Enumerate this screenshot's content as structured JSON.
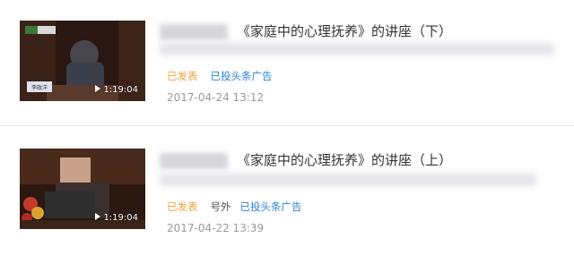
{
  "articles": [
    {
      "title": "《家庭中的心理抚养》的讲座（下）",
      "duration": "1:19:04",
      "status": "已发表",
      "extra": "",
      "channel": "已投头条广告",
      "date": "2017-04-24 13:12",
      "thumb_caption": "李政洋"
    },
    {
      "title": "《家庭中的心理抚养》的讲座（上）",
      "duration": "1:19:04",
      "status": "已发表",
      "extra": "号外",
      "channel": "已投头条广告",
      "date": "2017-04-22 13:39"
    }
  ],
  "colors": {
    "status": "#f0a43c",
    "channel": "#2b82d6",
    "date": "#9a9a9a",
    "title": "#333333",
    "divider": "#e7e7eb"
  },
  "icons": {
    "duration": "play-icon"
  }
}
